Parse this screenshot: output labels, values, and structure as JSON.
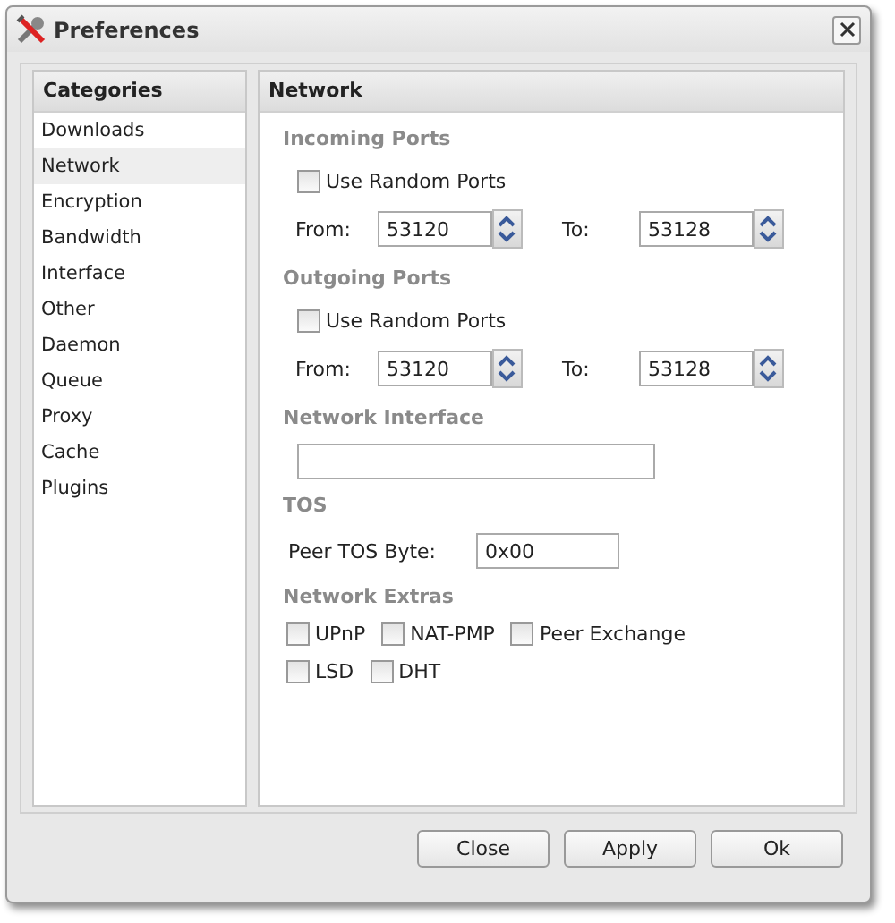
{
  "window": {
    "title": "Preferences"
  },
  "categories": {
    "title": "Categories",
    "items": [
      {
        "label": "Downloads",
        "selected": false
      },
      {
        "label": "Network",
        "selected": true
      },
      {
        "label": "Encryption",
        "selected": false
      },
      {
        "label": "Bandwidth",
        "selected": false
      },
      {
        "label": "Interface",
        "selected": false
      },
      {
        "label": "Other",
        "selected": false
      },
      {
        "label": "Daemon",
        "selected": false
      },
      {
        "label": "Queue",
        "selected": false
      },
      {
        "label": "Proxy",
        "selected": false
      },
      {
        "label": "Cache",
        "selected": false
      },
      {
        "label": "Plugins",
        "selected": false
      }
    ]
  },
  "panel": {
    "title": "Network",
    "sections": [
      {
        "heading": "Incoming Ports",
        "rows": [
          {
            "kind": "check",
            "items": [
              {
                "label": "Use Random Ports",
                "checked": false
              }
            ]
          },
          {
            "kind": "range",
            "from_label": "From:",
            "from": "53120",
            "to_label": "To:",
            "to": "53128"
          }
        ]
      },
      {
        "heading": "Outgoing Ports",
        "rows": [
          {
            "kind": "check",
            "items": [
              {
                "label": "Use Random Ports",
                "checked": false
              }
            ]
          },
          {
            "kind": "range",
            "from_label": "From:",
            "from": "53120",
            "to_label": "To:",
            "to": "53128"
          }
        ]
      },
      {
        "heading": "Network Interface",
        "rows": [
          {
            "kind": "field"
          }
        ]
      },
      {
        "heading": "TOS",
        "rows": [
          {
            "kind": "labeled",
            "label": "Peer TOS Byte:",
            "value": "0x00"
          }
        ]
      },
      {
        "heading": "Network Extras",
        "rows": [
          {
            "kind": "checks",
            "items": [
              {
                "label": "UPnP",
                "checked": false
              },
              {
                "label": "NAT-PMP",
                "checked": false
              },
              {
                "label": "Peer Exchange",
                "checked": false
              }
            ]
          },
          {
            "kind": "checks",
            "items": [
              {
                "label": "LSD",
                "checked": false
              },
              {
                "label": "DHT",
                "checked": false
              }
            ]
          }
        ]
      }
    ]
  },
  "buttons": [
    "Close",
    "Apply",
    "Ok"
  ]
}
